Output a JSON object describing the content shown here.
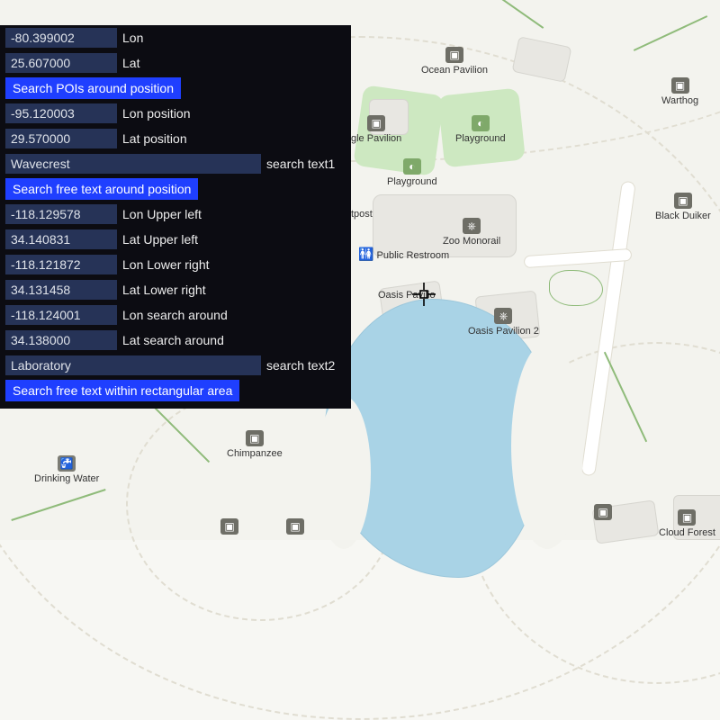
{
  "panel": {
    "row1": {
      "lon_value": "-80.399002",
      "lon_label": "Lon",
      "lat_value": "25.607000",
      "lat_label": "Lat"
    },
    "btn1": "Search POIs around position",
    "row2": {
      "lon_value": "-95.120003",
      "lon_label": "Lon position",
      "lat_value": "29.570000",
      "lat_label": "Lat position"
    },
    "search1": {
      "value": "Wavecrest",
      "label": "search text1"
    },
    "btn2": "Search free text around position",
    "rect": {
      "ul_lon": "-118.129578",
      "ul_lon_label": "Lon Upper left",
      "ul_lat": "34.140831",
      "ul_lat_label": "Lat Upper left",
      "lr_lon": "-118.121872",
      "lr_lon_label": "Lon Lower right",
      "lr_lat": "34.131458",
      "lr_lat_label": "Lat Lower right",
      "sa_lon": "-118.124001",
      "sa_lon_label": "Lon search around",
      "sa_lat": "34.138000",
      "sa_lat_label": "Lat search around"
    },
    "search2": {
      "value": "Laboratory",
      "label": "search text2"
    },
    "btn3": "Search free text within rectangular area"
  },
  "map": {
    "pois": {
      "ocean_pavilion": "Ocean Pavilion",
      "warthog": "Warthog",
      "jungle_pavilion": "gle Pavilion",
      "playground1": "Playground",
      "playground2": "Playground",
      "black_duiker": "Black Duiker",
      "outpost": "tpost",
      "zoo_monorail": "Zoo Monorail",
      "public_restroom": "Public Restroom",
      "oasis_pavilion": "Oasis Pavilio",
      "oasis_pavilion2": "Oasis Pavilion 2",
      "chimpanzee": "Chimpanzee",
      "drinking_water": "Drinking Water",
      "cloud_forest": "Cloud Forest"
    }
  }
}
